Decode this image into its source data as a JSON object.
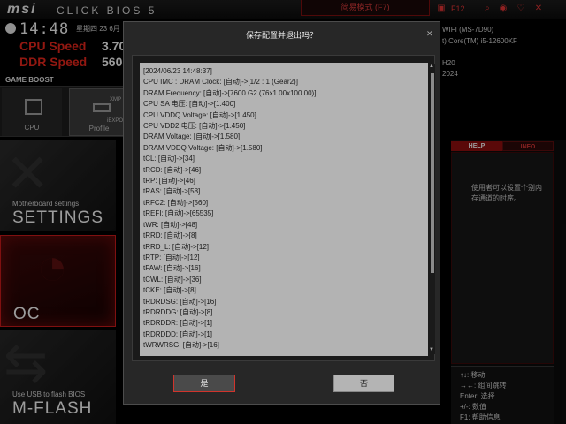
{
  "topbar": {
    "logo": "msi",
    "title": "CLICK BIOS 5",
    "mode": "简易模式 (F7)",
    "f12": "F12"
  },
  "status": {
    "time": "14:48",
    "date": "星期四 23 6月",
    "cpu_speed_label": "CPU Speed",
    "cpu_speed_value": "3.70",
    "ddr_speed_label": "DDR Speed",
    "ddr_speed_value": "560",
    "sysinfo": [
      "WIFI (MS-7D90)",
      "t) Core(TM) i5-12600KF",
      "",
      "H20",
      "2024"
    ]
  },
  "game_boost": {
    "label": "GAME BOOST",
    "cpu": "CPU",
    "profile": "Profile",
    "xmp": "XMP",
    "iexpo": "iEXPO"
  },
  "nav": {
    "settings_sub": "Motherboard settings",
    "settings": "SETTINGS",
    "oc": "OC",
    "mflash_sub": "Use USB to flash BIOS",
    "mflash": "M-FLASH"
  },
  "help": {
    "tab_help": "HELP",
    "tab_info": "INFO",
    "text": "使用者可以设置个别内存通道的时序。",
    "keys": [
      "↑↓: 移动",
      "→←: 组间跳转",
      "Enter: 选择",
      "+/-: 数值",
      "F1: 帮助信息"
    ]
  },
  "dialog": {
    "title": "保存配置并退出吗？",
    "yes": "是",
    "no": "否",
    "log": [
      "[2024/06/23 14:48:37]",
      "CPU IMC : DRAM Clock: [自动]->[1/2 : 1 (Gear2)]",
      "DRAM Frequency: [自动]->[7600 G2 (76x1.00x100.00)]",
      "CPU SA 电压: [自动]->[1.400]",
      "CPU VDDQ Voltage: [自动]->[1.450]",
      "CPU VDD2 电压: [自动]->[1.450]",
      "DRAM Voltage: [自动]->[1.580]",
      "DRAM VDDQ Voltage: [自动]->[1.580]",
      "tCL: [自动]->[34]",
      "tRCD: [自动]->[46]",
      "tRP: [自动]->[46]",
      "tRAS: [自动]->[58]",
      "tRFC2: [自动]->[560]",
      "tREFI: [自动]->[65535]",
      "tWR: [自动]->[48]",
      "tRRD: [自动]->[8]",
      "tRRD_L: [自动]->[12]",
      "tRTP: [自动]->[12]",
      "tFAW: [自动]->[16]",
      "tCWL: [自动]->[36]",
      "tCKE: [自动]->[8]",
      "tRDRDSG: [自动]->[16]",
      "tRDRDDG: [自动]->[8]",
      "tRDRDDR: [自动]->[1]",
      "tRDRDDD: [自动]->[1]",
      "tWRWRSG: [自动]->[16]"
    ]
  }
}
